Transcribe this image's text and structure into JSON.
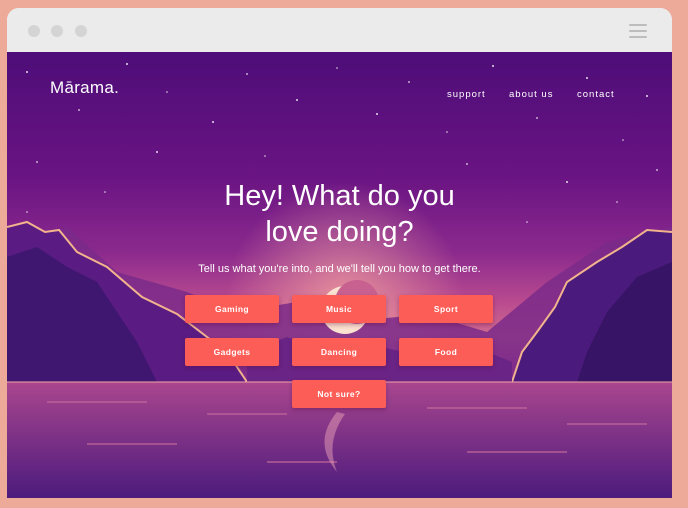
{
  "brand": {
    "logo": "Mārama."
  },
  "nav": {
    "support": "support",
    "about": "about us",
    "contact": "contact"
  },
  "hero": {
    "headline_line1": "Hey! What do you",
    "headline_line2": "love doing?",
    "subtitle": "Tell us what you're into, and we'll tell you how to get there."
  },
  "options": [
    "Gaming",
    "Music",
    "Sport",
    "Gadgets",
    "Dancing",
    "Food",
    "Not sure?"
  ],
  "colors": {
    "button": "#fd5d57",
    "sky_top": "#4d0d78",
    "frame": "#eeaa98"
  },
  "icons": {
    "menu": "hamburger-menu-icon",
    "moon": "crescent-moon-icon"
  }
}
